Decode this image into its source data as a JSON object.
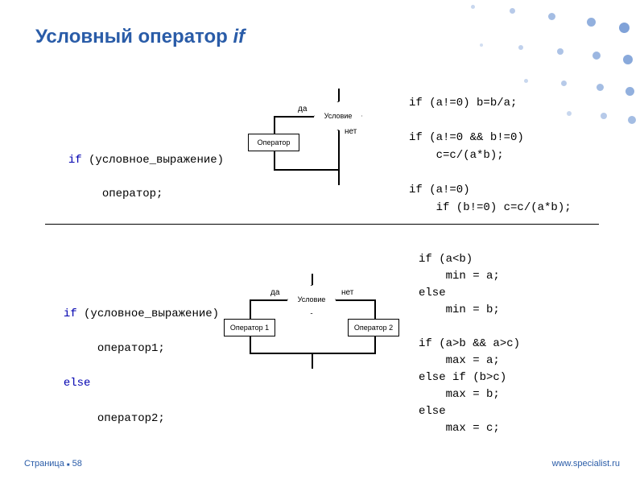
{
  "title_main": "Условный оператор ",
  "title_if": "if",
  "code_left1": {
    "l1a": "if",
    "l1b": " (условное_выражение)",
    "l2": "     оператор;"
  },
  "code_left2": {
    "l1a": "if",
    "l1b": " (условное_выражение)",
    "l2": "     оператор1;",
    "l3a": "else",
    "l4": "     оператор2;"
  },
  "code_right1": "if (a!=0) b=b/a;\n\nif (a!=0 && b!=0)\n    c=c/(a*b);\n\nif (a!=0)\n    if (b!=0) c=c/(a*b);",
  "code_right2": "if (a<b)\n    min = a;\nelse\n    min = b;\n\nif (a>b && a>c)\n    max = a;\nelse if (b>c)\n    max = b;\nelse\n    max = c;",
  "fc": {
    "condition": "Условие",
    "operator": "Оператор",
    "op1": "Оператор 1",
    "op2": "Оператор 2",
    "yes": "да",
    "no": "нет"
  },
  "footer": {
    "page": "Страница ",
    "pnum": "58",
    "url": "www.specialist.ru"
  }
}
